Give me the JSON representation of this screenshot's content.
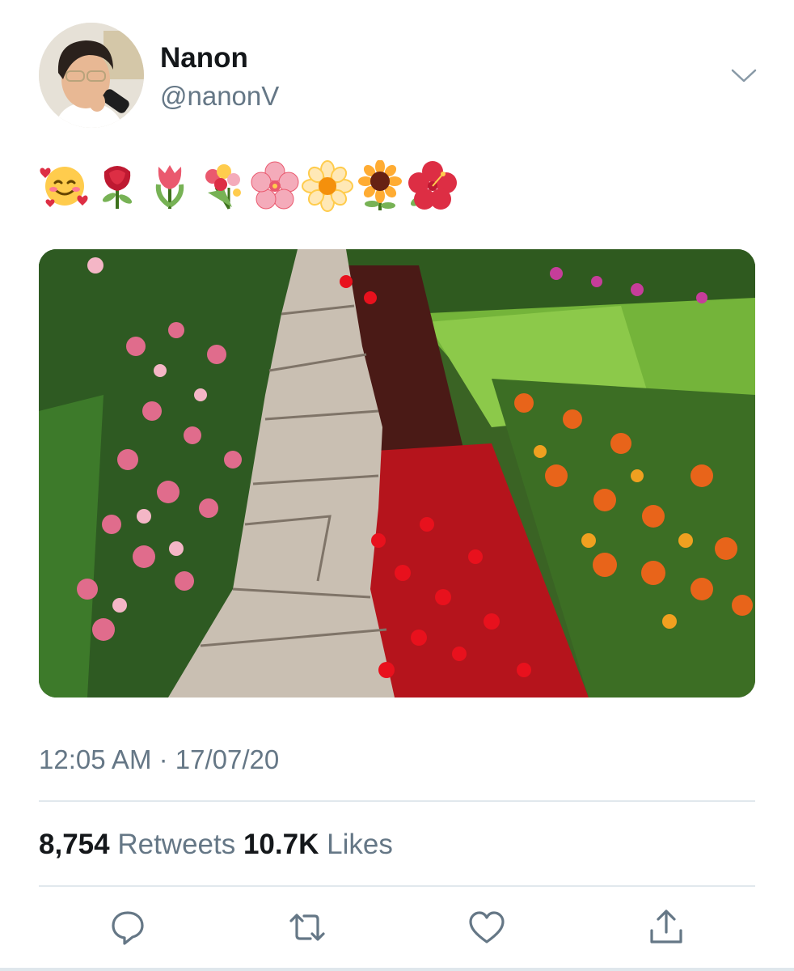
{
  "author": {
    "display_name": "Nanon",
    "handle": "@nanonV",
    "avatar_icon": "person-singing-avatar"
  },
  "tweet": {
    "emojis": [
      "smiling-face-with-hearts",
      "rose",
      "tulip",
      "bouquet",
      "cherry-blossom",
      "blossom",
      "sunflower",
      "hibiscus"
    ],
    "media_icon": "flower-garden-path-photo",
    "timestamp": "12:05 AM · 17/07/20"
  },
  "stats": {
    "retweets_count": "8,754",
    "retweets_label": "Retweets",
    "likes_count": "10.7K",
    "likes_label": "Likes"
  },
  "actions": [
    "reply-icon",
    "retweet-icon",
    "like-icon",
    "share-icon"
  ],
  "colors": {
    "text_primary": "#14171a",
    "text_secondary": "#657786",
    "icon": "#657786",
    "divider": "#e1e8ed"
  }
}
